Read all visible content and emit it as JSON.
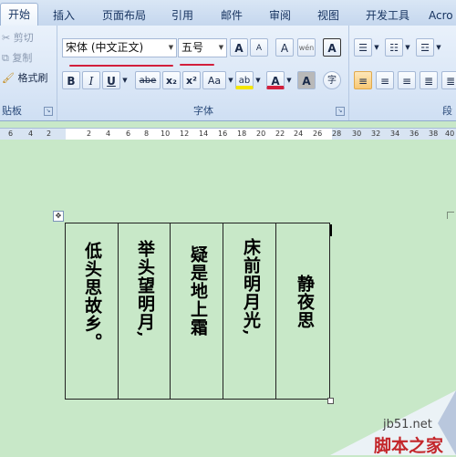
{
  "tabs": [
    "开始",
    "插入",
    "页面布局",
    "引用",
    "邮件",
    "审阅",
    "视图",
    "开发工具",
    "Acro"
  ],
  "clipboard": {
    "cut": "剪切",
    "copy": "复制",
    "format_painter": "格式刷",
    "group_label": "贴板"
  },
  "font": {
    "name": "宋体 (中文正文)",
    "size": "五号",
    "group_label": "字体",
    "grow_label": "A",
    "shrink_label": "A",
    "clear_label": "A",
    "phonetic_label": "wén",
    "border_char_label": "A",
    "bold_label": "B",
    "italic_label": "I",
    "underline_label": "U",
    "strike_label": "abe",
    "subscript_label": "x₂",
    "superscript_label": "x²",
    "case_label": "Aa",
    "highlight_label": "ab",
    "color_label": "A",
    "shade_label": "A",
    "circle_char_label": "字"
  },
  "paragraph": {
    "group_label": "段"
  },
  "ruler": {
    "numbers": [
      "6",
      "4",
      "2",
      "2",
      "4",
      "6",
      "8",
      "10",
      "12",
      "14",
      "16",
      "18",
      "20",
      "22",
      "24",
      "26",
      "28",
      "30",
      "32",
      "34",
      "36",
      "38",
      "40"
    ]
  },
  "poem": {
    "columns": [
      "低头思故乡。",
      "举头望明月,",
      "疑是地上霜",
      "床前明月光,",
      "静夜思"
    ]
  },
  "watermark": {
    "site": "jb51.net",
    "name": "脚本之家"
  },
  "colors": {
    "accent_red": "#d21f3c",
    "document_bg": "#c8e8c8",
    "ribbon_bg": "#dce8f7"
  }
}
